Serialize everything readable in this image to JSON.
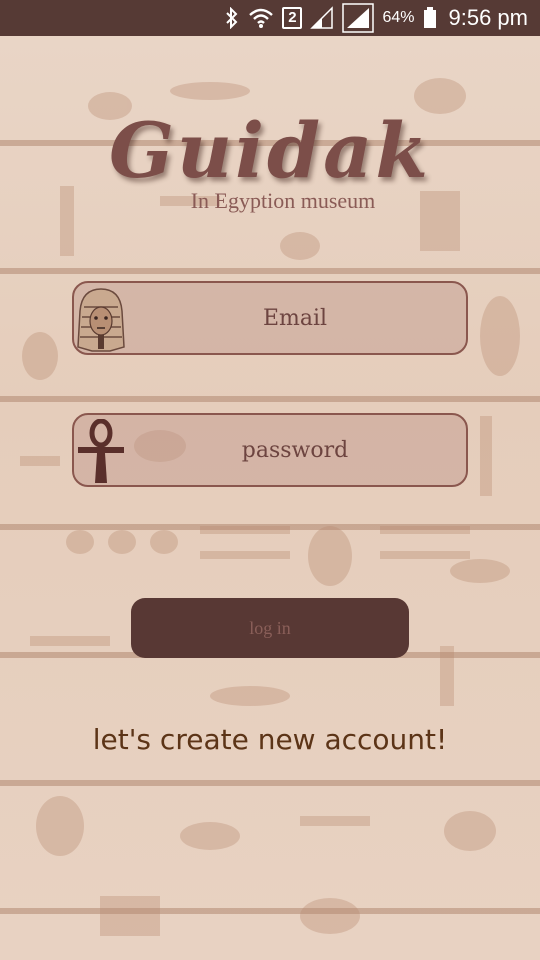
{
  "status_bar": {
    "icons": [
      "bluetooth-icon",
      "wifi-icon",
      "sim-2-indicator",
      "signal-icon",
      "signal-icon-2",
      "battery-icon"
    ],
    "sim_slot": "2",
    "battery_percent": "64%",
    "time": "9:56 pm"
  },
  "logo": {
    "title": "Guidak",
    "tagline": "In Egyption museum"
  },
  "form": {
    "email_placeholder": "Email",
    "email_icon": "pharaoh-mask-icon",
    "password_placeholder": "password",
    "password_icon": "ankh-icon",
    "login_label": "log in",
    "create_account_label": "let's create new account!"
  },
  "colors": {
    "status_bar_bg": "#563a35",
    "brand": "#7c4e49",
    "button_bg": "#583834",
    "link_text": "#5c3417"
  }
}
